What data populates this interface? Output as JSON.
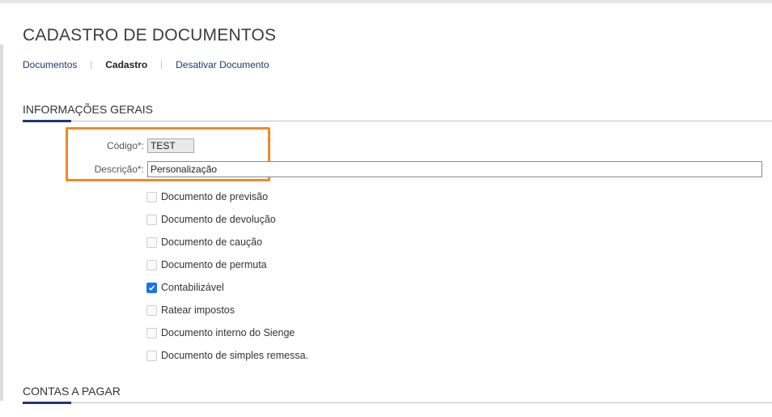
{
  "page": {
    "title": "CADASTRO DE DOCUMENTOS"
  },
  "breadcrumb": {
    "items": [
      {
        "label": "Documentos"
      },
      {
        "label": "Cadastro"
      },
      {
        "label": "Desativar Documento"
      }
    ],
    "separator": "|"
  },
  "sections": {
    "general": "INFORMAÇÕES GERAIS",
    "payables": "CONTAS A PAGAR"
  },
  "form": {
    "codigo": {
      "label": "Código*:",
      "value": "TEST"
    },
    "descricao": {
      "label": "Descrição*:",
      "value": "Personalização"
    }
  },
  "checkboxes": [
    {
      "label": "Documento de previsão",
      "checked": false
    },
    {
      "label": "Documento de devolução",
      "checked": false
    },
    {
      "label": "Documento de caução",
      "checked": false
    },
    {
      "label": "Documento de permuta",
      "checked": false
    },
    {
      "label": "Contabilizável",
      "checked": true
    },
    {
      "label": "Ratear impostos",
      "checked": false
    },
    {
      "label": "Documento interno do Sienge",
      "checked": false
    },
    {
      "label": "Documento de simples remessa.",
      "checked": false
    }
  ],
  "colors": {
    "accent": "#1f3a6e",
    "highlight": "#f08a24",
    "checkbox_checked": "#1a73e8"
  }
}
